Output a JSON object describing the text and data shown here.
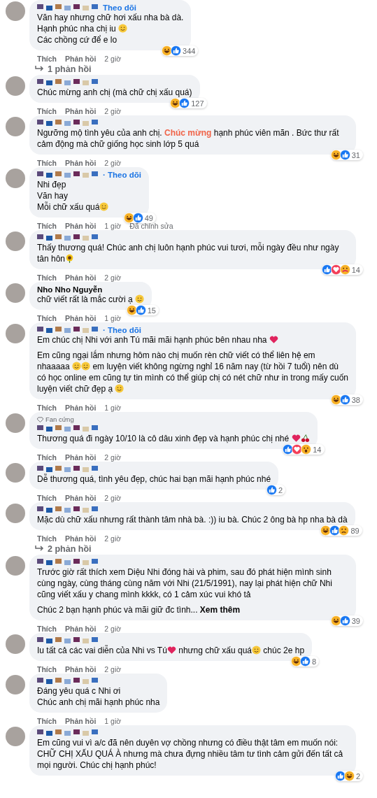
{
  "thread": [
    {
      "kind": "comment",
      "author": {
        "kind": "pixelated"
      },
      "follow": "Theo dõi",
      "paragraphs": [
        [
          {
            "kind": "text",
            "text": "Văn hay nhưng chữ hơi xấu nha bà dà."
          }
        ],
        [
          {
            "kind": "text",
            "text": "Hạnh phúc nha chị iu "
          },
          {
            "kind": "face"
          }
        ],
        [
          {
            "kind": "text",
            "text": "Các chồng cứ để e lo"
          }
        ]
      ],
      "reactions": [
        {
          "kind": "haha"
        },
        {
          "kind": "like"
        }
      ],
      "count": "344",
      "actions": [
        "Thích",
        "Phản hồi"
      ],
      "time": "2 giờ"
    },
    {
      "kind": "replies",
      "label": "1 phản hồi"
    },
    {
      "kind": "comment",
      "author": {
        "kind": "pixelated"
      },
      "paragraphs": [
        [
          {
            "kind": "text",
            "text": "Chúc mừng anh chị (mà chữ chị xấu quá)"
          }
        ]
      ],
      "reactions": [
        {
          "kind": "haha"
        },
        {
          "kind": "like"
        }
      ],
      "count": "127",
      "actions": [
        "Thích",
        "Phản hồi"
      ],
      "time": "2 giờ"
    },
    {
      "kind": "comment",
      "author": {
        "kind": "pixelated"
      },
      "paragraphs": [
        [
          {
            "kind": "text",
            "text": "Ngưỡng mộ tình yêu của anh chị. "
          },
          {
            "kind": "highlight",
            "text": "Chúc mừng"
          },
          {
            "kind": "text",
            "text": " hạnh phúc viên mãn . Bức thư rất cảm động mà chữ giống học sinh lớp 5 quá"
          }
        ]
      ],
      "reactions": [
        {
          "kind": "haha"
        },
        {
          "kind": "like"
        }
      ],
      "count": "31",
      "actions": [
        "Thích",
        "Phản hồi"
      ],
      "time": "2 giờ"
    },
    {
      "kind": "comment",
      "author": {
        "kind": "pixelated"
      },
      "follow": "· Theo dõi",
      "paragraphs": [
        [
          {
            "kind": "text",
            "text": "Nhi đẹp"
          }
        ],
        [
          {
            "kind": "text",
            "text": "Văn hay"
          }
        ],
        [
          {
            "kind": "text",
            "text": "Mỗi chữ xấu quá"
          },
          {
            "kind": "face"
          }
        ]
      ],
      "reactions": [
        {
          "kind": "haha"
        },
        {
          "kind": "like"
        }
      ],
      "count": "49",
      "actions": [
        "Thích",
        "Phản hồi"
      ],
      "time": "1 giờ",
      "edited": "Đã chỉnh sửa"
    },
    {
      "kind": "comment",
      "author": {
        "kind": "pixelated"
      },
      "paragraphs": [
        [
          {
            "kind": "text",
            "text": "Thấy thương quá! Chúc anh chị luôn hạnh phúc vui tươi, mỗi ngày đều như ngày tân hôn"
          },
          {
            "kind": "flower"
          }
        ]
      ],
      "reactions": [
        {
          "kind": "like"
        },
        {
          "kind": "love"
        },
        {
          "kind": "care"
        }
      ],
      "count": "14",
      "actions": [
        "Thích",
        "Phản hồi"
      ],
      "time": "2 giờ"
    },
    {
      "kind": "comment",
      "author": {
        "kind": "text",
        "name": "Nho Nho Nguyễn"
      },
      "paragraphs": [
        [
          {
            "kind": "text",
            "text": "chữ viết rất là mắc cười ạ "
          },
          {
            "kind": "face"
          }
        ]
      ],
      "reactions": [
        {
          "kind": "haha"
        },
        {
          "kind": "like"
        }
      ],
      "count": "15",
      "actions": [
        "Thích",
        "Phản hồi"
      ],
      "time": "1 giờ"
    },
    {
      "kind": "comment",
      "author": {
        "kind": "pixelated"
      },
      "follow": "· Theo dõi",
      "paragraphs": [
        [
          {
            "kind": "text",
            "text": "Em chúc chị Nhi với anh Tú mãi mãi hạnh phúc bên nhau nha "
          },
          {
            "kind": "heart"
          }
        ],
        [
          {
            "kind": "text",
            "text": "Em cũng ngại lắm nhưng hôm nào chị muốn rèn chữ viết có thể liên hệ em nhaaaaa "
          },
          {
            "kind": "face"
          },
          {
            "kind": "face"
          },
          {
            "kind": "text",
            "text": " em luyện viết không ngừng nghỉ 16 năm nay (từ hồi 7 tuổi) nên dù có học online em cũng tự tin mình có thể giúp chị có nét chữ như in trong mấy cuốn luyện viết chữ đẹp ạ "
          },
          {
            "kind": "face"
          }
        ]
      ],
      "reactions": [
        {
          "kind": "haha"
        },
        {
          "kind": "like"
        }
      ],
      "count": "38",
      "actions": [
        "Thích",
        "Phản hồi"
      ],
      "time": "1 giờ"
    },
    {
      "kind": "comment",
      "author": {
        "kind": "pixelated"
      },
      "badge": "Fan cứng",
      "paragraphs": [
        [
          {
            "kind": "text",
            "text": "Thương quá đi ngày 10/10 là cô dâu xinh đẹp và hạnh phúc chị nhé "
          },
          {
            "kind": "heart"
          },
          {
            "kind": "cherries"
          }
        ]
      ],
      "reactions": [
        {
          "kind": "like"
        },
        {
          "kind": "love"
        },
        {
          "kind": "wow"
        }
      ],
      "count": "14",
      "actions": [
        "Thích",
        "Phản hồi"
      ],
      "time": "2 giờ"
    },
    {
      "kind": "comment",
      "author": {
        "kind": "pixelated"
      },
      "paragraphs": [
        [
          {
            "kind": "text",
            "text": "Dễ thương quá, tình yêu đẹp, chúc hai bạn mãi hạnh phúc nhé"
          }
        ]
      ],
      "reactions": [
        {
          "kind": "like"
        }
      ],
      "count": "2",
      "actions": [
        "Thích",
        "Phản hồi"
      ],
      "time": "2 giờ"
    },
    {
      "kind": "comment",
      "author": {
        "kind": "pixelated"
      },
      "paragraphs": [
        [
          {
            "kind": "text",
            "text": "Mặc dù chữ xấu nhưng rất thành tâm nhà bà. :)) iu bà. Chúc 2 ông bà hp nha bà dà"
          }
        ]
      ],
      "reactions": [
        {
          "kind": "haha"
        },
        {
          "kind": "like"
        },
        {
          "kind": "sad"
        }
      ],
      "count": "89",
      "actions": [
        "Thích",
        "Phản hồi"
      ],
      "time": "2 giờ"
    },
    {
      "kind": "replies",
      "label": "2 phản hồi"
    },
    {
      "kind": "comment",
      "author": {
        "kind": "pixelated"
      },
      "paragraphs": [
        [
          {
            "kind": "text",
            "text": "Trước giờ rất thích xem Diệu Nhi đóng hài và phim, sau đó phát hiện mình sinh cùng ngày, cùng tháng cùng năm với Nhi (21/5/1991), nay lại phát hiện chữ Nhi cũng viết xấu y chang mình kkkk, có 1 cảm xúc vui khó tả"
          }
        ],
        [
          {
            "kind": "text",
            "text": "Chúc 2 bạn hạnh phúc và mãi giữ đc tình... "
          },
          {
            "kind": "link",
            "text": "Xem thêm"
          }
        ]
      ],
      "reactions": [
        {
          "kind": "haha"
        },
        {
          "kind": "like"
        }
      ],
      "count": "39",
      "actions": [
        "Thích",
        "Phản hồi"
      ],
      "time": "2 giờ"
    },
    {
      "kind": "comment",
      "author": {
        "kind": "pixelated"
      },
      "paragraphs": [
        [
          {
            "kind": "text",
            "text": "Iu tất cả các vai diễn của Nhi vs Tú"
          },
          {
            "kind": "heart"
          },
          {
            "kind": "text",
            "text": " nhưng chữ xấu quá"
          },
          {
            "kind": "face"
          },
          {
            "kind": "text",
            "text": " chúc 2e hp"
          }
        ]
      ],
      "reactions": [
        {
          "kind": "haha"
        },
        {
          "kind": "like"
        }
      ],
      "count": "8",
      "actions": [
        "Thích",
        "Phản hồi"
      ],
      "time": "2 giờ"
    },
    {
      "kind": "comment",
      "author": {
        "kind": "pixelated"
      },
      "paragraphs": [
        [
          {
            "kind": "text",
            "text": "Đáng yêu quá c Nhi ơi"
          }
        ],
        [
          {
            "kind": "text",
            "text": "Chúc anh chị mãi hạnh phúc nha"
          }
        ]
      ],
      "actions": [
        "Thích",
        "Phản hồi"
      ],
      "time": "1 giờ"
    },
    {
      "kind": "comment",
      "author": {
        "kind": "pixelated"
      },
      "paragraphs": [
        [
          {
            "kind": "text",
            "text": "Em cũng vui vì a/c đã nên duyên vợ chồng nhưng có điều thật tâm em muốn nói: CHỮ CHỊ XẤU QUÁ À nhưng mà chưa đựng nhiều tâm tư tình cảm gửi đến tất cả mọi người. Chúc chị hạnh phúc!"
          }
        ]
      ],
      "reactions": [
        {
          "kind": "like"
        },
        {
          "kind": "haha"
        }
      ],
      "count": "2"
    }
  ]
}
